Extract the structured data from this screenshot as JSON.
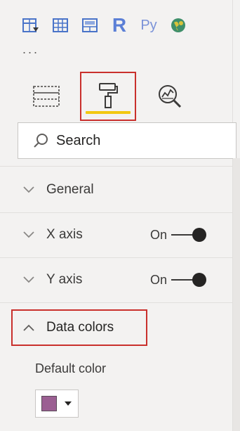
{
  "visualizations": {
    "icons": [
      {
        "name": "table-icon"
      },
      {
        "name": "matrix-icon"
      },
      {
        "name": "key-influencers-icon"
      },
      {
        "name": "r-visual",
        "text": "R"
      },
      {
        "name": "python-visual",
        "text": "Py"
      },
      {
        "name": "map-icon"
      }
    ],
    "more_label": "..."
  },
  "pane_tabs": {
    "fields": "fields-tab",
    "format": "format-tab",
    "analytics": "analytics-tab",
    "active": "format",
    "active_color": "#f2c811"
  },
  "search": {
    "placeholder": "Search",
    "value": ""
  },
  "sections": {
    "general": {
      "label": "General"
    },
    "x_axis": {
      "label": "X axis",
      "toggle": "On"
    },
    "y_axis": {
      "label": "Y axis",
      "toggle": "On"
    },
    "data_colors": {
      "label": "Data colors",
      "expanded": true
    }
  },
  "data_colors": {
    "default_color_label": "Default color",
    "default_color": "#9b5f92"
  },
  "colors": {
    "highlight_border": "#c9302c",
    "accent": "#f2c811"
  }
}
